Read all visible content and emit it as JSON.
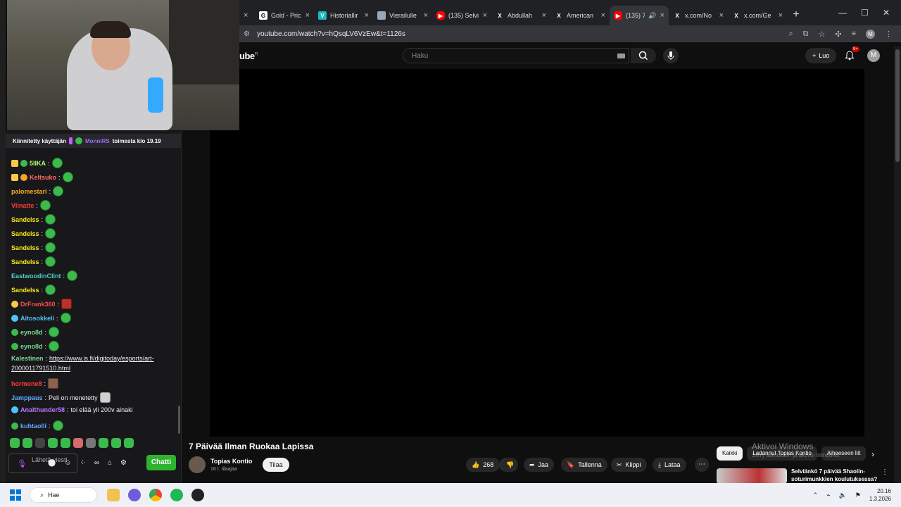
{
  "browser": {
    "tabs": [
      {
        "title": "Gold - Pric",
        "favicon_color": "#ffffff",
        "favicon_glyph": "G"
      },
      {
        "title": "Historiallir",
        "favicon_color": "#17b8c4",
        "favicon_glyph": "V"
      },
      {
        "title": "Vierailulle",
        "favicon_color": "#9aa7b8",
        "favicon_glyph": ""
      },
      {
        "title": "(135) Selvi",
        "favicon_color": "#ff0000",
        "favicon_glyph": "▶"
      },
      {
        "title": "Abdullah",
        "favicon_color": "#202124",
        "favicon_glyph": "X"
      },
      {
        "title": "American",
        "favicon_color": "#202124",
        "favicon_glyph": "X"
      },
      {
        "title": "(135) 7",
        "favicon_color": "#ff0000",
        "favicon_glyph": "▶"
      },
      {
        "title": "x.com/No",
        "favicon_color": "#202124",
        "favicon_glyph": "X"
      },
      {
        "title": "x.com/Ge",
        "favicon_color": "#202124",
        "favicon_glyph": "X"
      }
    ],
    "new_tab": "+",
    "url": "youtube.com/watch?v=hQsqLV6VzEw&t=1126s",
    "profile_initial": "M"
  },
  "youtube": {
    "logo": "ube",
    "logo_region": "FI",
    "search_placeholder": "Haku",
    "create_label": "Luo",
    "notifications": "9+",
    "avatar": "M",
    "video_title": "7 Päivää Ilman Ruokaa Lapissa",
    "channel": "Topias Kontio",
    "subscribers": "16 t. tilaajaa",
    "subscribe_label": "Tilaa",
    "likes": "268",
    "share_label": "Jaa",
    "save_label": "Tallenna",
    "clip_label": "Klippi",
    "download_label": "Lataa",
    "chips": [
      "Kaikki",
      "Ladannut Topias Kontio",
      "Aiheeseen liit"
    ],
    "activate_title": "Aktivoi Windows",
    "activate_sub": "Siirry asetuksiin ja aktivoi Windows.",
    "rec_title": "Selviänkö 7 päivää Shaolin-soturimunkkien koulutuksessa?"
  },
  "chat": {
    "pinned_prefix": "Kiinnitetty käyttäjän",
    "pinned_user": "MonniRS",
    "pinned_suffix": "toimesta klo 19.19",
    "messages": [
      {
        "name": "5IIKA",
        "color": "#b6ff6e",
        "text": ""
      },
      {
        "name": "Keltsuko",
        "color": "#ff6b6b",
        "text": ""
      },
      {
        "name": "palomestari",
        "color": "#f5a623",
        "text": ""
      },
      {
        "name": "Viinatte",
        "color": "#ff3c3c",
        "text": ""
      },
      {
        "name": "Sandelss",
        "color": "#f8e71c",
        "text": ""
      },
      {
        "name": "Sandelss",
        "color": "#f8e71c",
        "text": ""
      },
      {
        "name": "Sandelss",
        "color": "#f8e71c",
        "text": ""
      },
      {
        "name": "Sandelss",
        "color": "#f8e71c",
        "text": ""
      },
      {
        "name": "EastwoodinClint",
        "color": "#4fd1c5",
        "text": ""
      },
      {
        "name": "Sandelss",
        "color": "#f8e71c",
        "text": ""
      },
      {
        "name": "DrFrank360",
        "color": "#ff4b4b",
        "text": ""
      },
      {
        "name": "Aitosokkeli",
        "color": "#4fc3f7",
        "text": ""
      },
      {
        "name": "eyno8d",
        "color": "#7bd88f",
        "text": ""
      },
      {
        "name": "eyno8d",
        "color": "#7bd88f",
        "text": ""
      },
      {
        "name": "Kalestinen",
        "color": "#7bd88f",
        "text": "https://www.is.fi/digitoday/esports/art-"
      },
      {
        "name": "",
        "color": "#efeff1",
        "text": "2000011791510.html"
      },
      {
        "name": "hormone8",
        "color": "#ff3c3c",
        "text": ""
      },
      {
        "name": "Jamppaus",
        "color": "#61a8ff",
        "text": "Peli on menetetty"
      },
      {
        "name": "Analthunder58",
        "color": "#b277ff",
        "text": "toi elää yli 200v ainaki"
      },
      {
        "name": "kuhtaolli",
        "color": "#61a8ff",
        "text": ""
      }
    ],
    "input_placeholder": "Lähetä viesti",
    "chat_button": "Chatti"
  },
  "taskbar": {
    "search_label": "Hae",
    "time": "20.16",
    "date": "1.3.2026"
  }
}
